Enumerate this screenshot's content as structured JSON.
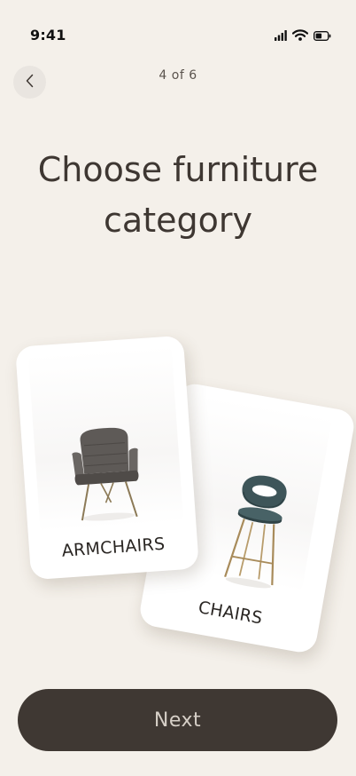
{
  "status_bar": {
    "time": "9:41",
    "icons": [
      "cellular-signal-icon",
      "wifi-icon",
      "battery-icon"
    ]
  },
  "header": {
    "back_icon": "chevron-left-icon",
    "step": "4 of 6"
  },
  "title": {
    "line1": "Choose furniture",
    "line2": "category"
  },
  "categories": [
    {
      "label": "ARMCHAIRS",
      "image": "armchair-image"
    },
    {
      "label": "CHAIRS",
      "image": "bar-stool-image"
    }
  ],
  "footer": {
    "next_label": "Next"
  },
  "colors": {
    "background": "#f4f0ea",
    "button": "#3f3833",
    "button_text": "#d6cfc7",
    "text": "#3e3732"
  }
}
